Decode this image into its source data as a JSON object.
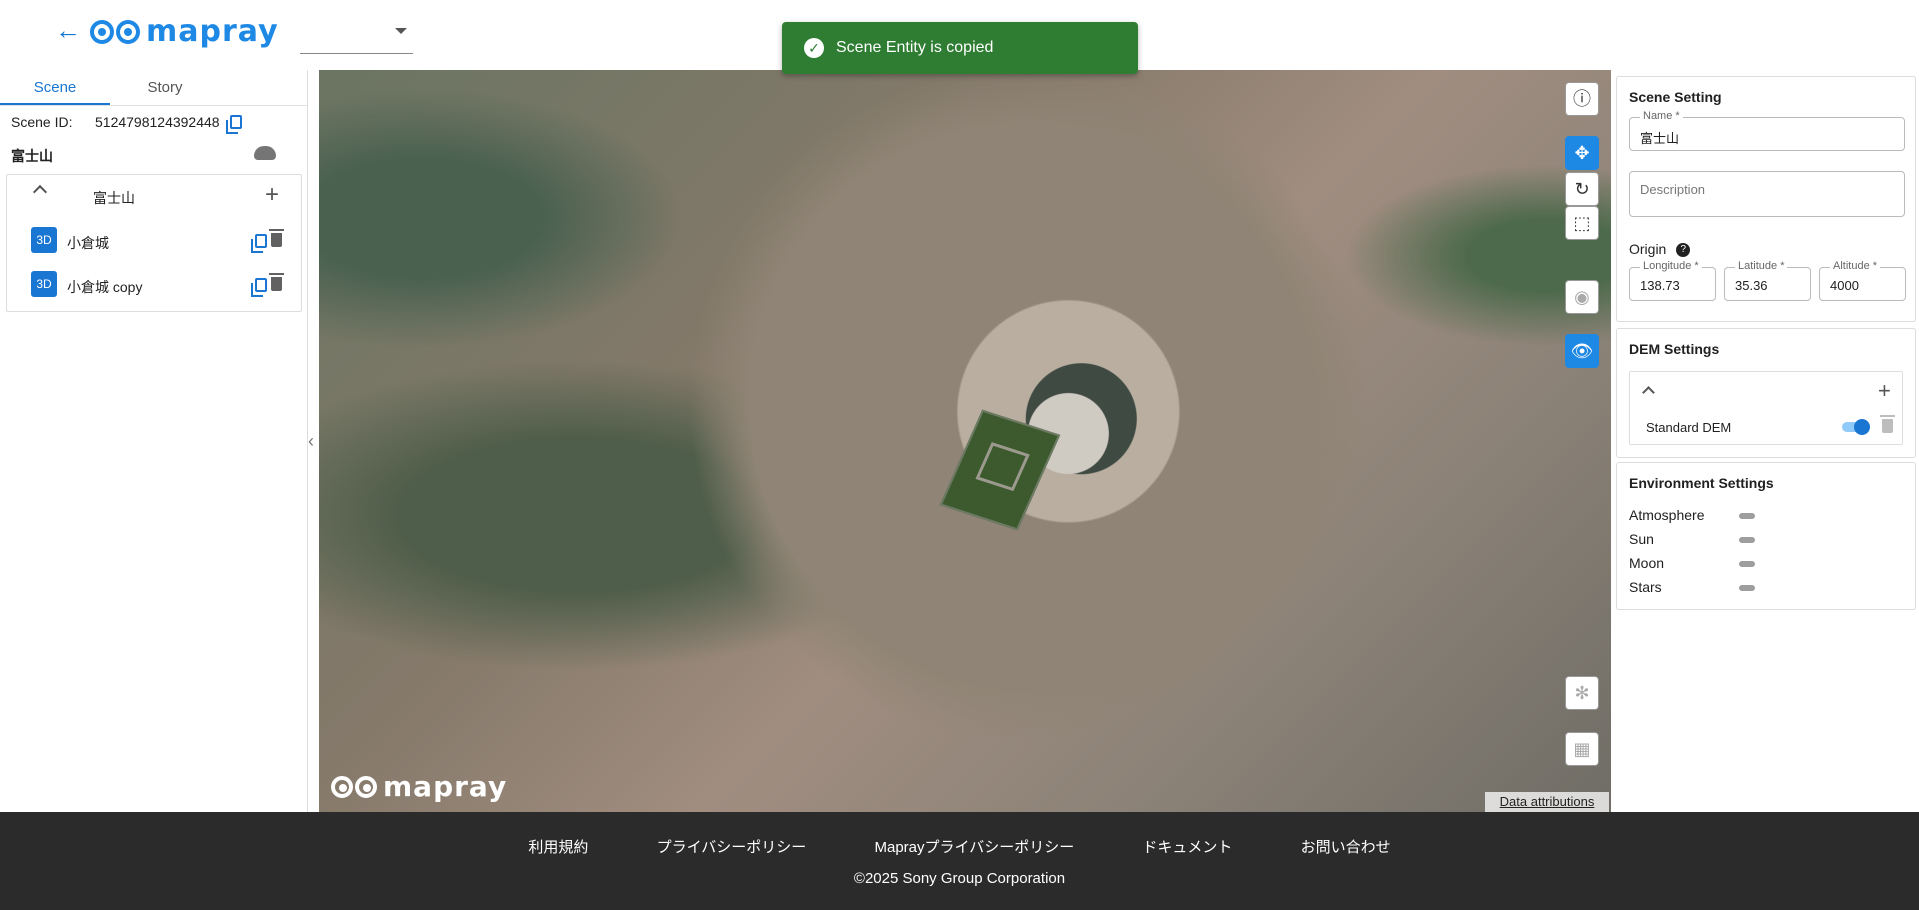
{
  "header": {
    "back_icon": "arrow-left-icon",
    "logo_text": "mapray",
    "select_value": ""
  },
  "toast": {
    "message": "Scene Entity is copied",
    "color": "#2e7d32"
  },
  "left_panel": {
    "tabs": [
      {
        "label": "Scene",
        "active": true
      },
      {
        "label": "Story",
        "active": false
      }
    ],
    "scene_id_label": "Scene ID:",
    "scene_id_value": "5124798124392448",
    "scene_name": "富士山",
    "tree": {
      "group_name": "富士山",
      "items": [
        {
          "badge": "3D",
          "label": "小倉城"
        },
        {
          "badge": "3D",
          "label": "小倉城 copy"
        }
      ]
    }
  },
  "map": {
    "logo_text": "mapray",
    "attribution": "Data attributions",
    "controls": [
      "info-icon",
      "move-icon",
      "rotate-icon",
      "select-area-icon",
      "target-icon",
      "eye-icon",
      "compass-icon",
      "buildings-icon"
    ]
  },
  "right_panel": {
    "scene_setting": {
      "title": "Scene Setting",
      "name_label": "Name *",
      "name_value": "富士山",
      "description_placeholder": "Description",
      "origin_label": "Origin",
      "longitude_label": "Longitude *",
      "longitude_value": "138.73",
      "latitude_label": "Latitude *",
      "latitude_value": "35.36",
      "altitude_label": "Altitude *",
      "altitude_value": "4000"
    },
    "dem_settings": {
      "title": "DEM Settings",
      "item": "Standard DEM"
    },
    "environment_settings": {
      "title": "Environment Settings",
      "items": [
        "Atmosphere",
        "Sun",
        "Moon",
        "Stars"
      ]
    }
  },
  "footer": {
    "links": [
      "利用規約",
      "プライバシーポリシー",
      "Maprayプライバシーポリシー",
      "ドキュメント",
      "お問い合わせ"
    ],
    "copyright": "©2025 Sony Group Corporation"
  },
  "colors": {
    "accent": "#1976d2",
    "footer_bg": "#2b2b2b"
  }
}
